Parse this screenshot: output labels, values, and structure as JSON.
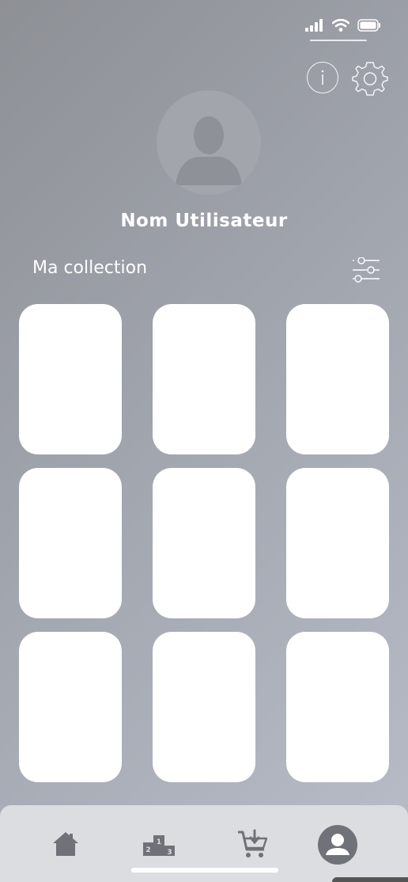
{
  "profile": {
    "username": "Nom Utilisateur"
  },
  "collection": {
    "title": "Ma collection",
    "cards": [
      {},
      {},
      {},
      {},
      {},
      {},
      {},
      {},
      {}
    ]
  },
  "topbar": {
    "info_icon": "info-icon",
    "settings_icon": "gear-icon"
  },
  "nav": {
    "items": [
      "home-icon",
      "podium-icon",
      "cart-icon",
      "profile-icon"
    ],
    "podium_numbers": [
      "2",
      "1",
      "3"
    ]
  }
}
